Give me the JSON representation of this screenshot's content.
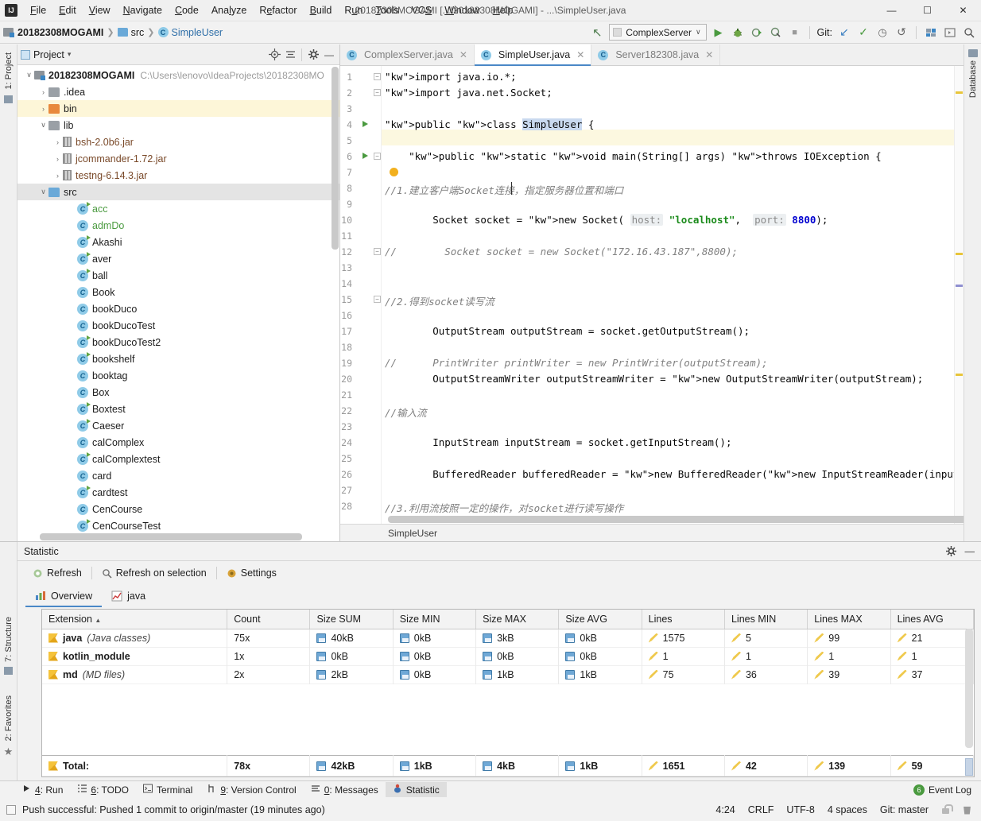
{
  "window": {
    "title": "20182308MOGAMI [...\\20182308MOGAMI] - ...\\SimpleUser.java",
    "minimize": "—",
    "maximize": "☐",
    "close": "✕"
  },
  "menu": [
    "File",
    "Edit",
    "View",
    "Navigate",
    "Code",
    "Analyze",
    "Refactor",
    "Build",
    "Run",
    "Tools",
    "VCS",
    "Window",
    "Help"
  ],
  "breadcrumb": [
    {
      "label": "20182308MOGAMI",
      "icon": "project-icon",
      "style": "bold"
    },
    {
      "label": "src",
      "icon": "folder-icon",
      "style": "plain"
    },
    {
      "label": "SimpleUser",
      "icon": "class-icon",
      "style": "link"
    }
  ],
  "toolbar": {
    "back_arrow": "↖",
    "run_config": "ComplexServer",
    "chevron": "∨",
    "run": "▶",
    "debug": "debug-icon",
    "run_coverage": "coverage-icon",
    "profile": "profile-icon",
    "stop": "■",
    "git_label": "Git:",
    "git_update": "↙",
    "git_commit": "✓",
    "git_history": "◷",
    "git_revert": "↺",
    "settings": "settings-icon",
    "layout": "layout-icon",
    "search": "search-icon"
  },
  "left_strip": {
    "project_tab": "1: Project"
  },
  "right_strip": {
    "database_tab": "Database"
  },
  "stat_strip": {
    "structure_tab": "7: Structure",
    "favorites_tab": "2: Favorites"
  },
  "project": {
    "header": "Project",
    "header_chevron": "▾",
    "locate_icon": "target-icon",
    "collapse_icon": "collapse-all-icon",
    "gear_icon": "gear-icon",
    "hide_icon": "—",
    "tree": [
      {
        "label": "20182308MOGAMI",
        "path": "C:\\Users\\lenovo\\IdeaProjects\\20182308MO",
        "indent": 0,
        "arrow": "∨",
        "icon": "project-icon",
        "bold": true,
        "highlight": ""
      },
      {
        "label": ".idea",
        "indent": 1,
        "arrow": "›",
        "icon": "folder-gray",
        "highlight": ""
      },
      {
        "label": "bin",
        "indent": 1,
        "arrow": "›",
        "icon": "folder-orange",
        "highlight": "yellow"
      },
      {
        "label": "lib",
        "indent": 1,
        "arrow": "∨",
        "icon": "folder-gray",
        "highlight": ""
      },
      {
        "label": "bsh-2.0b6.jar",
        "indent": 2,
        "arrow": "›",
        "icon": "jar-icon",
        "highlight": ""
      },
      {
        "label": "jcommander-1.72.jar",
        "indent": 2,
        "arrow": "›",
        "icon": "jar-icon",
        "highlight": ""
      },
      {
        "label": "testng-6.14.3.jar",
        "indent": 2,
        "arrow": "›",
        "icon": "jar-icon",
        "highlight": ""
      },
      {
        "label": "src",
        "indent": 1,
        "arrow": "∨",
        "icon": "folder-blue",
        "highlight": "gray"
      },
      {
        "label": "acc",
        "indent": 3,
        "arrow": "",
        "icon": "class-run-icon",
        "green": true,
        "highlight": ""
      },
      {
        "label": "admDo",
        "indent": 3,
        "arrow": "",
        "icon": "class-icon",
        "green": true,
        "highlight": ""
      },
      {
        "label": "Akashi",
        "indent": 3,
        "arrow": "",
        "icon": "class-run-icon",
        "highlight": ""
      },
      {
        "label": "aver",
        "indent": 3,
        "arrow": "",
        "icon": "class-run-icon",
        "highlight": ""
      },
      {
        "label": "ball",
        "indent": 3,
        "arrow": "",
        "icon": "class-run-icon",
        "highlight": ""
      },
      {
        "label": "Book",
        "indent": 3,
        "arrow": "",
        "icon": "class-icon",
        "highlight": ""
      },
      {
        "label": "bookDuco",
        "indent": 3,
        "arrow": "",
        "icon": "class-icon",
        "highlight": ""
      },
      {
        "label": "bookDucoTest",
        "indent": 3,
        "arrow": "",
        "icon": "class-icon",
        "highlight": ""
      },
      {
        "label": "bookDucoTest2",
        "indent": 3,
        "arrow": "",
        "icon": "class-run-icon",
        "highlight": ""
      },
      {
        "label": "bookshelf",
        "indent": 3,
        "arrow": "",
        "icon": "class-run-icon",
        "highlight": ""
      },
      {
        "label": "booktag",
        "indent": 3,
        "arrow": "",
        "icon": "class-icon",
        "highlight": ""
      },
      {
        "label": "Box",
        "indent": 3,
        "arrow": "",
        "icon": "class-icon",
        "highlight": ""
      },
      {
        "label": "Boxtest",
        "indent": 3,
        "arrow": "",
        "icon": "class-run-icon",
        "highlight": ""
      },
      {
        "label": "Caeser",
        "indent": 3,
        "arrow": "",
        "icon": "class-run-icon",
        "highlight": ""
      },
      {
        "label": "calComplex",
        "indent": 3,
        "arrow": "",
        "icon": "class-icon",
        "highlight": ""
      },
      {
        "label": "calComplextest",
        "indent": 3,
        "arrow": "",
        "icon": "class-run-icon",
        "highlight": ""
      },
      {
        "label": "card",
        "indent": 3,
        "arrow": "",
        "icon": "class-icon",
        "highlight": ""
      },
      {
        "label": "cardtest",
        "indent": 3,
        "arrow": "",
        "icon": "class-run-icon",
        "highlight": ""
      },
      {
        "label": "CenCourse",
        "indent": 3,
        "arrow": "",
        "icon": "class-icon",
        "highlight": ""
      },
      {
        "label": "CenCourseTest",
        "indent": 3,
        "arrow": "",
        "icon": "class-run-icon",
        "highlight": ""
      }
    ]
  },
  "editor": {
    "tabs": [
      {
        "label": "ComplexServer.java",
        "active": false,
        "close": "✕"
      },
      {
        "label": "SimpleUser.java",
        "active": true,
        "close": "✕"
      },
      {
        "label": "Server182308.java",
        "active": false,
        "close": "✕"
      }
    ],
    "breadcrumb_bottom": "SimpleUser",
    "lines": [
      {
        "n": 1,
        "text": "import java.io.*;"
      },
      {
        "n": 2,
        "text": "import java.net.Socket;"
      },
      {
        "n": 3,
        "text": ""
      },
      {
        "n": 4,
        "text": "public class SimpleUser {"
      },
      {
        "n": 5,
        "text": ""
      },
      {
        "n": 6,
        "text": "    public static void main(String[] args) throws IOException {"
      },
      {
        "n": 7,
        "text": ""
      },
      {
        "n": 8,
        "text": "//1.建立客户端Socket连接，指定服务器位置和端口"
      },
      {
        "n": 9,
        "text": ""
      },
      {
        "n": 10,
        "text": "        Socket socket = new Socket( host: \"localhost\",  port: 8800);"
      },
      {
        "n": 11,
        "text": ""
      },
      {
        "n": 12,
        "text": "//        Socket socket = new Socket(\"172.16.43.187\",8800);"
      },
      {
        "n": 13,
        "text": ""
      },
      {
        "n": 14,
        "text": ""
      },
      {
        "n": 15,
        "text": "//2.得到socket读写流"
      },
      {
        "n": 16,
        "text": ""
      },
      {
        "n": 17,
        "text": "        OutputStream outputStream = socket.getOutputStream();"
      },
      {
        "n": 18,
        "text": ""
      },
      {
        "n": 19,
        "text": "//      PrintWriter printWriter = new PrintWriter(outputStream);"
      },
      {
        "n": 20,
        "text": "        OutputStreamWriter outputStreamWriter = new OutputStreamWriter(outputStream);"
      },
      {
        "n": 21,
        "text": ""
      },
      {
        "n": 22,
        "text": "//输入流"
      },
      {
        "n": 23,
        "text": ""
      },
      {
        "n": 24,
        "text": "        InputStream inputStream = socket.getInputStream();"
      },
      {
        "n": 25,
        "text": ""
      },
      {
        "n": 26,
        "text": "        BufferedReader bufferedReader = new BufferedReader(new InputStreamReader(inputStream,  charsetN"
      },
      {
        "n": 27,
        "text": ""
      },
      {
        "n": 28,
        "text": "//3.利用流按照一定的操作，对socket进行读写操作"
      }
    ]
  },
  "statistic": {
    "title": "Statistic",
    "gear_icon": "gear-icon",
    "hide_icon": "—",
    "buttons": [
      {
        "label": "Refresh",
        "icon": "refresh-icon"
      },
      {
        "label": "Refresh on selection",
        "icon": "search-icon"
      },
      {
        "label": "Settings",
        "icon": "settings-icon"
      }
    ],
    "tabs": [
      {
        "label": "Overview",
        "icon": "overview-icon",
        "active": true
      },
      {
        "label": "java",
        "icon": "chart-icon",
        "active": false
      }
    ],
    "table": {
      "columns": [
        "Extension",
        "Count",
        "Size SUM",
        "Size MIN",
        "Size MAX",
        "Size AVG",
        "Lines",
        "Lines MIN",
        "Lines MAX",
        "Lines AVG"
      ],
      "sort_indicator": "▲",
      "rows": [
        {
          "ext": "java",
          "desc": "(Java classes)",
          "count": "75x",
          "size_sum": "40kB",
          "size_min": "0kB",
          "size_max": "3kB",
          "size_avg": "0kB",
          "lines": "1575",
          "lines_min": "5",
          "lines_max": "99",
          "lines_avg": "21"
        },
        {
          "ext": "kotlin_module",
          "desc": "",
          "count": "1x",
          "size_sum": "0kB",
          "size_min": "0kB",
          "size_max": "0kB",
          "size_avg": "0kB",
          "lines": "1",
          "lines_min": "1",
          "lines_max": "1",
          "lines_avg": "1"
        },
        {
          "ext": "md",
          "desc": "(MD files)",
          "count": "2x",
          "size_sum": "2kB",
          "size_min": "0kB",
          "size_max": "1kB",
          "size_avg": "1kB",
          "lines": "75",
          "lines_min": "36",
          "lines_max": "39",
          "lines_avg": "37"
        }
      ],
      "total": {
        "ext": "Total:",
        "count": "78x",
        "size_sum": "42kB",
        "size_min": "1kB",
        "size_max": "4kB",
        "size_avg": "1kB",
        "lines": "1651",
        "lines_min": "42",
        "lines_max": "139",
        "lines_avg": "59"
      }
    }
  },
  "tool_tabs": [
    {
      "num": "4",
      "label": ": Run",
      "icon": "run-icon",
      "active": false
    },
    {
      "num": "6",
      "label": ": TODO",
      "icon": "todo-icon",
      "active": false
    },
    {
      "num": "",
      "label": "Terminal",
      "icon": "terminal-icon",
      "active": false
    },
    {
      "num": "9",
      "label": ": Version Control",
      "icon": "vcs-icon",
      "active": false
    },
    {
      "num": "0",
      "label": ": Messages",
      "icon": "messages-icon",
      "active": false
    },
    {
      "num": "",
      "label": "Statistic",
      "icon": "statistic-icon",
      "active": true
    }
  ],
  "event_log": {
    "label": "Event Log",
    "count": "6"
  },
  "status": {
    "message": "Push successful: Pushed 1 commit to origin/master (19 minutes ago)",
    "caret": "4:24",
    "line_sep": "CRLF",
    "encoding": "UTF-8",
    "indent": "4 spaces",
    "branch": "Git: master",
    "lock_icon": "unlock-icon",
    "trash_icon": "trash-icon"
  }
}
